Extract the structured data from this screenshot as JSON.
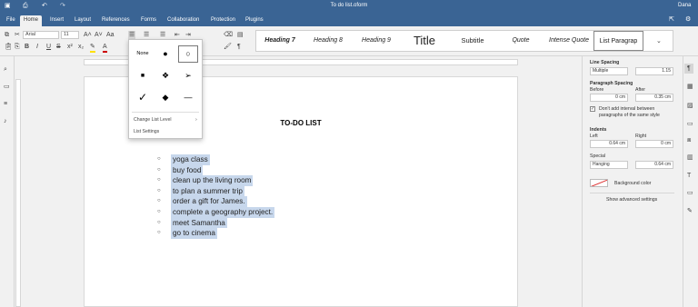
{
  "app": {
    "title": "To do list.oform",
    "user": "Dana"
  },
  "tabs": [
    "File",
    "Home",
    "Insert",
    "Layout",
    "References",
    "Forms",
    "Collaboration",
    "Protection",
    "Plugins"
  ],
  "font": {
    "family": "Arial",
    "size": "11"
  },
  "styles": [
    "Heading 7",
    "Heading 8",
    "Heading 9",
    "Title",
    "Subtitle",
    "Quote",
    "Intense Quote",
    "List Paragrap"
  ],
  "document": {
    "title": "TO-DO LIST",
    "items": [
      "yoga class",
      "buy food",
      "clean up the living room",
      "to plan a summer trip",
      "order a gift for James.",
      "complete a geography project.",
      "meet Samantha",
      "go to cinema"
    ]
  },
  "bullet_menu": {
    "none_label": "None",
    "change_level": "Change List Level",
    "settings": "List Settings"
  },
  "panel": {
    "line_spacing_label": "Line Spacing",
    "line_spacing_mode": "Multiple",
    "line_spacing_value": "1.15",
    "paragraph_spacing_label": "Paragraph Spacing",
    "before_label": "Before",
    "before_value": "0 cm",
    "after_label": "After",
    "after_value": "0.35 cm",
    "dont_add_interval": "Don't add interval between paragraphs of the same style",
    "indents_label": "Indents",
    "left_label": "Left",
    "left_value": "0.64 cm",
    "right_label": "Right",
    "right_value": "0 cm",
    "special_label": "Special",
    "special_mode": "Hanging",
    "special_value": "0.64 cm",
    "background_color": "Background color",
    "show_advanced": "Show advanced settings"
  }
}
